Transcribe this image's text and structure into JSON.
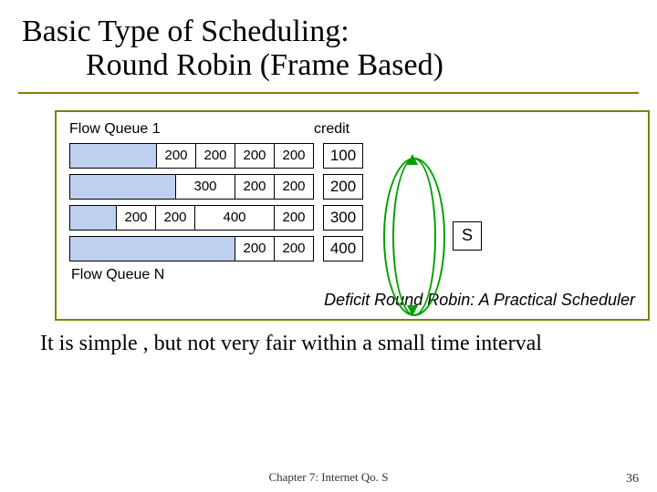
{
  "title": {
    "line1": "Basic  Type of Scheduling:",
    "line2": "Round Robin (Frame Based)"
  },
  "labels": {
    "flow_queue_1": "Flow Queue 1",
    "credit": "credit",
    "flow_queue_n": "Flow Queue N"
  },
  "rows": [
    {
      "packets": [
        "200",
        "200",
        "200",
        "200"
      ],
      "widths": [
        "w200",
        "w200",
        "w200",
        "w200"
      ],
      "credit": "100"
    },
    {
      "packets": [
        "300",
        "200",
        "200"
      ],
      "widths": [
        "w300",
        "w200",
        "w200"
      ],
      "credit": "200"
    },
    {
      "packets": [
        "200",
        "200",
        "400",
        "200"
      ],
      "widths": [
        "w200",
        "w200",
        "w400",
        "w200"
      ],
      "credit": "300"
    },
    {
      "packets": [
        "200",
        "200"
      ],
      "widths": [
        "w200",
        "w200"
      ],
      "credit": "400"
    }
  ],
  "server_label": "S",
  "drr_caption": "Deficit Round Robin: A Practical Scheduler",
  "bottom_text": "It is simple , but not very fair within a small time interval",
  "footer": "Chapter 7: Internet Qo. S",
  "page_number": "36"
}
